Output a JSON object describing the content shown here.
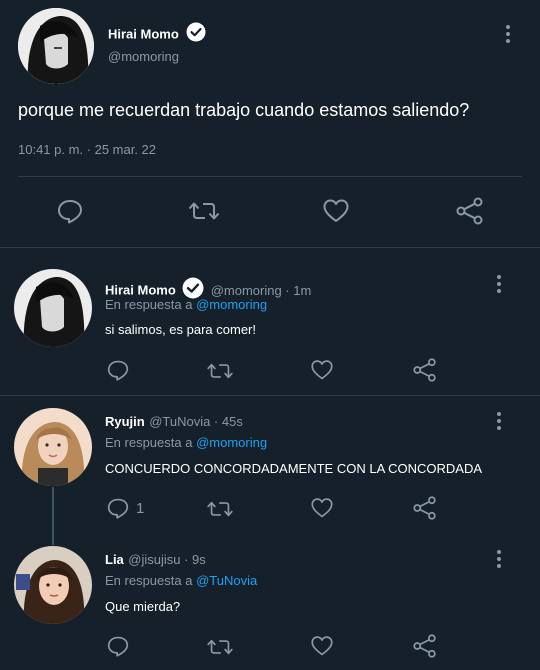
{
  "main_tweet": {
    "name": "Hirai Momo",
    "handle": "@momoring",
    "text": "porque me recuerdan trabajo cuando estamos saliendo?",
    "timestamp": "10:41 p. m. · 25 mar. 22",
    "actions": [
      "reply-icon",
      "retweet-icon",
      "like-icon",
      "share-icon"
    ]
  },
  "replies": [
    {
      "name": "Hirai Momo",
      "handle_time": "@momoring · 1m",
      "reply_prefix": "En respuesta a",
      "reply_to": "@momoring",
      "text": "si salimos, es para comer!",
      "reply_count": ""
    },
    {
      "name": "Ryujin",
      "handle_time": "@TuNovia · 45s",
      "reply_prefix": "En respuesta a",
      "reply_to": "@momoring",
      "text": "CONCUERDO CONCORDADAMENTE CON LA CONCORDADA",
      "reply_count": "1"
    },
    {
      "name": "Lia",
      "handle_time": "@jisujisu · 9s",
      "reply_prefix": "En respuesta a",
      "reply_to": "@TuNovia",
      "text": "Que mierda?",
      "reply_count": ""
    }
  ],
  "colors": {
    "background": "#15202b",
    "text": "#ffffff",
    "muted": "#8899a6",
    "link": "#1da1f2",
    "divider": "#2f3b47"
  }
}
